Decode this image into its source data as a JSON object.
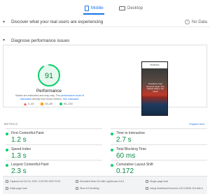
{
  "tabs": [
    {
      "label": "Mobile",
      "icon": "smartphone-icon",
      "selected": true
    },
    {
      "label": "Desktop",
      "icon": "desktop-icon",
      "selected": false
    }
  ],
  "sections": {
    "field": {
      "title": "Discover what your real users are experiencing",
      "status": "No Data",
      "status_icon": "info-icon"
    },
    "diagnose": {
      "title": "Diagnose performance issues"
    }
  },
  "score": {
    "value": 91,
    "fraction": 0.91,
    "label": "Performance",
    "desc_1": "Values are estimated and may vary. The",
    "desc_link_1": "performance score is calculated",
    "desc_2": "directly from these metrics.",
    "desc_link_2": "See calculator.",
    "legend": [
      {
        "label": "0–49",
        "shape": "triangle",
        "color": "#ff4e42"
      },
      {
        "label": "50–89",
        "shape": "square",
        "color": "#ffa400"
      },
      {
        "label": "90–100",
        "shape": "circle",
        "color": "#0cce6b"
      }
    ],
    "color": "#0cce6b"
  },
  "screenshot": {
    "header": "MUSINGS",
    "headline": "Transform Your Summer Style: The Hottest Styles You Need"
  },
  "metrics_header": {
    "title": "METRICS",
    "expand": "Expand view"
  },
  "metrics": [
    {
      "name": "First Contentful Paint",
      "value": "1.2 s"
    },
    {
      "name": "Time to Interactive",
      "value": "2.7 s"
    },
    {
      "name": "Speed Index",
      "value": "1.3 s"
    },
    {
      "name": "Total Blocking Time",
      "value": "60 ms"
    },
    {
      "name": "Largest Contentful Paint",
      "value": "2.3 s"
    },
    {
      "name": "Cumulative Layout Shift",
      "value": "0.172"
    }
  ],
  "footer": [
    {
      "text": "Captured at Oct 19, 2022, 2:05 PM GMT+5:30",
      "icon": "calendar-icon"
    },
    {
      "text": "Emulated Moto G4 with Lighthouse 9.6.6",
      "icon": "phone-icon"
    },
    {
      "text": "Single page load",
      "icon": "user-icon"
    },
    {
      "text": "Initial page load",
      "icon": "timer-icon"
    },
    {
      "text": "Slow 4G throttling",
      "icon": "wifi-icon"
    },
    {
      "text": "Using HeadlessChromium 102.0.5005.115 with lr",
      "icon": "chrome-icon"
    }
  ]
}
